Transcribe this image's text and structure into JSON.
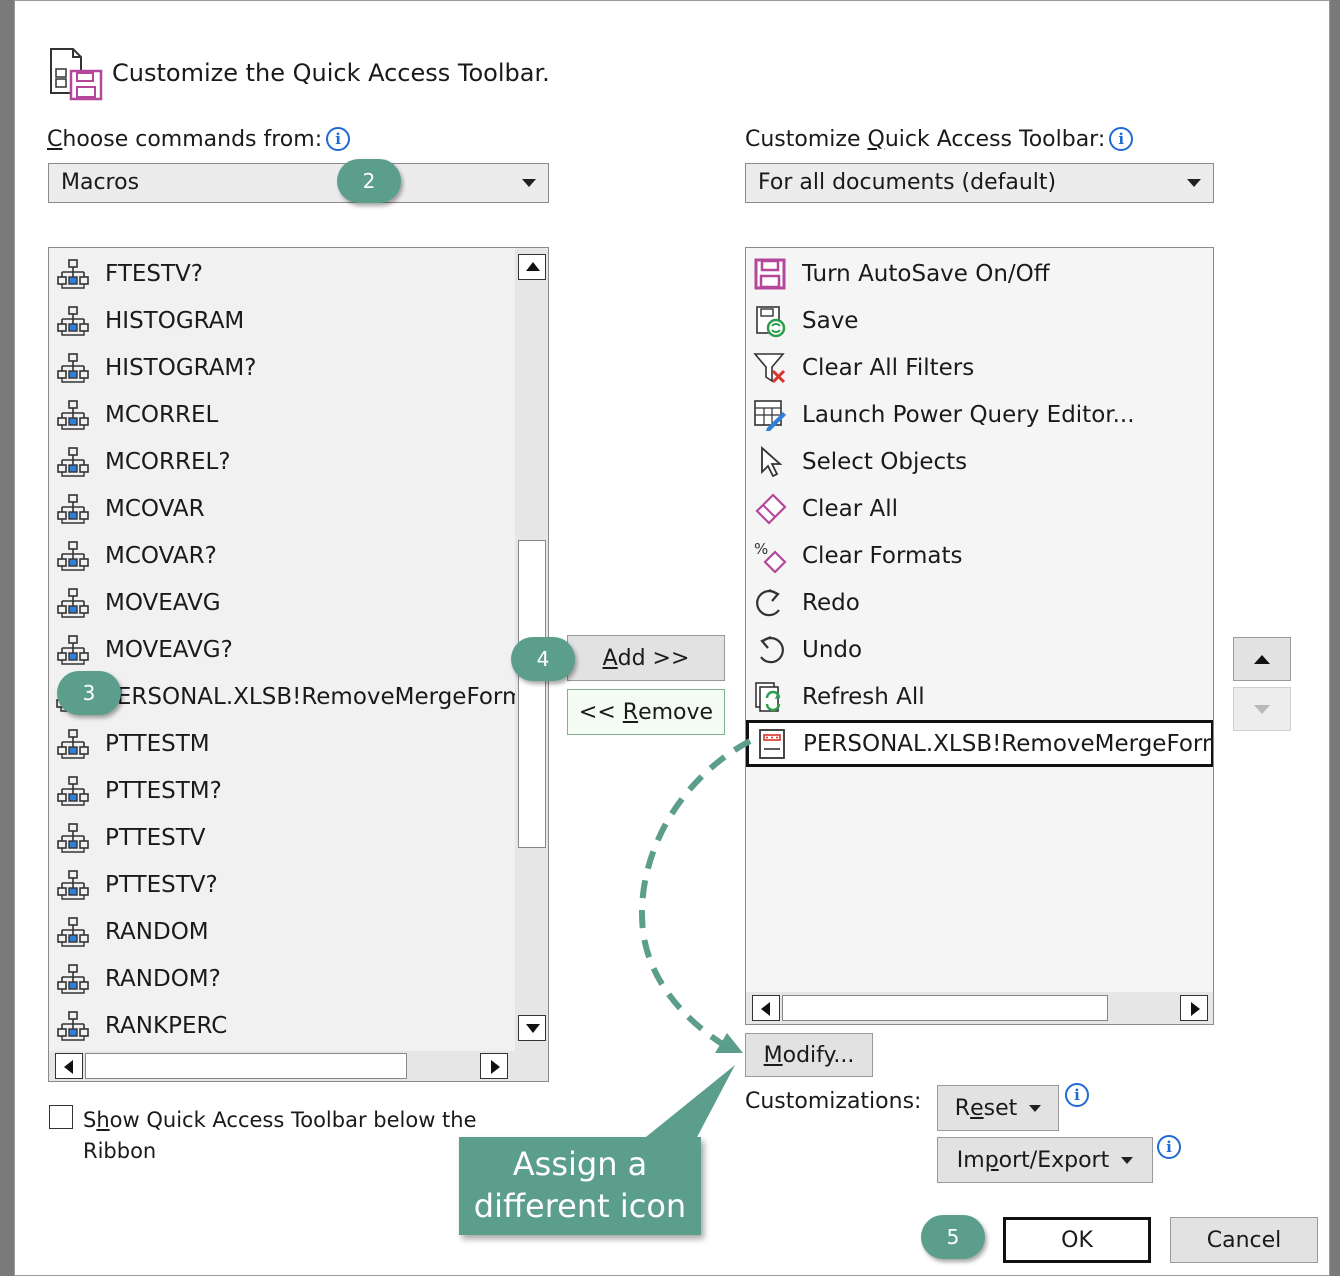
{
  "dialog": {
    "title": "Customize the Quick Access Toolbar."
  },
  "left": {
    "label_pre": "C",
    "label_rest": "hoose commands from:",
    "dropdown_value": "Macros",
    "items": [
      {
        "label": "FTESTV?",
        "icon": "macro-icon"
      },
      {
        "label": "HISTOGRAM",
        "icon": "macro-icon"
      },
      {
        "label": "HISTOGRAM?",
        "icon": "macro-icon"
      },
      {
        "label": "MCORREL",
        "icon": "macro-icon"
      },
      {
        "label": "MCORREL?",
        "icon": "macro-icon"
      },
      {
        "label": "MCOVAR",
        "icon": "macro-icon"
      },
      {
        "label": "MCOVAR?",
        "icon": "macro-icon"
      },
      {
        "label": "MOVEAVG",
        "icon": "macro-icon"
      },
      {
        "label": "MOVEAVG?",
        "icon": "macro-icon"
      },
      {
        "label": "PERSONAL.XLSB!RemoveMergeFormat",
        "icon": "macro-icon"
      },
      {
        "label": "PTTESTM",
        "icon": "macro-icon"
      },
      {
        "label": "PTTESTM?",
        "icon": "macro-icon"
      },
      {
        "label": "PTTESTV",
        "icon": "macro-icon"
      },
      {
        "label": "PTTESTV?",
        "icon": "macro-icon"
      },
      {
        "label": "RANDOM",
        "icon": "macro-icon"
      },
      {
        "label": "RANDOM?",
        "icon": "macro-icon"
      },
      {
        "label": "RANKPERC",
        "icon": "macro-icon"
      }
    ],
    "show_below_label_pre": "S",
    "show_below_label_u": "h",
    "show_below_label_rest": "ow Quick Access Toolbar below the",
    "show_below_label_line2": "Ribbon"
  },
  "right": {
    "label_pre": "Customize ",
    "label_u": "Q",
    "label_rest": "uick Access Toolbar:",
    "dropdown_value": "For all documents (default)",
    "items": [
      {
        "label": "Turn AutoSave On/Off",
        "icon": "autosave-icon"
      },
      {
        "label": "Save",
        "icon": "save-icon"
      },
      {
        "label": "Clear All Filters",
        "icon": "clear-filter-icon"
      },
      {
        "label": "Launch Power Query Editor...",
        "icon": "power-query-icon"
      },
      {
        "label": "Select Objects",
        "icon": "pointer-icon"
      },
      {
        "label": "Clear All",
        "icon": "eraser-icon"
      },
      {
        "label": "Clear Formats",
        "icon": "clear-formats-icon"
      },
      {
        "label": "Redo",
        "icon": "redo-icon"
      },
      {
        "label": "Undo",
        "icon": "undo-icon"
      },
      {
        "label": "Refresh All",
        "icon": "refresh-icon"
      },
      {
        "label": "PERSONAL.XLSB!RemoveMergeFormat",
        "icon": "macro-button-icon"
      }
    ],
    "customizations_label": "Customizations:",
    "reset_pre": "R",
    "reset_u": "e",
    "reset_rest": "set",
    "import_pre": "Im",
    "import_u": "p",
    "import_rest": "ort/Export",
    "modify_u": "M",
    "modify_rest": "odify..."
  },
  "buttons": {
    "add_u": "A",
    "add_rest": "dd >>",
    "remove_pre": "<< ",
    "remove_u": "R",
    "remove_rest": "emove",
    "ok": "OK",
    "cancel": "Cancel"
  },
  "callouts": {
    "c2": "2",
    "c3": "3",
    "c4": "4",
    "c5": "5",
    "assign_line1": "Assign a",
    "assign_line2": "different icon"
  },
  "colors": {
    "callout": "#5c9e8c",
    "info": "#1f6ad3",
    "autosave": "#b4479a"
  }
}
